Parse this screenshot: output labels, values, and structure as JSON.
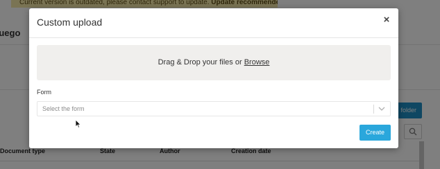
{
  "background": {
    "banner_text": "Current version is outdated, please contact support to update.",
    "banner_bold": "Update recommended",
    "page_title": "fuego",
    "folder_button": "folder",
    "columns": [
      "Document type",
      "State",
      "Author",
      "Creation date"
    ]
  },
  "modal": {
    "title": "Custom upload",
    "close_glyph": "×",
    "dropzone_prefix": "Drag & Drop your files or ",
    "dropzone_link": "Browse",
    "form_label": "Form",
    "form_select_placeholder": "Select the form",
    "create_label": "Create"
  },
  "colors": {
    "accent": "#2aa7dc",
    "overlay": "rgba(0,0,0,0.5)",
    "dropzone_bg": "#f0efed"
  },
  "icons": [
    "close-icon",
    "chevron-down-icon",
    "search-icon",
    "mouse-cursor-icon"
  ]
}
